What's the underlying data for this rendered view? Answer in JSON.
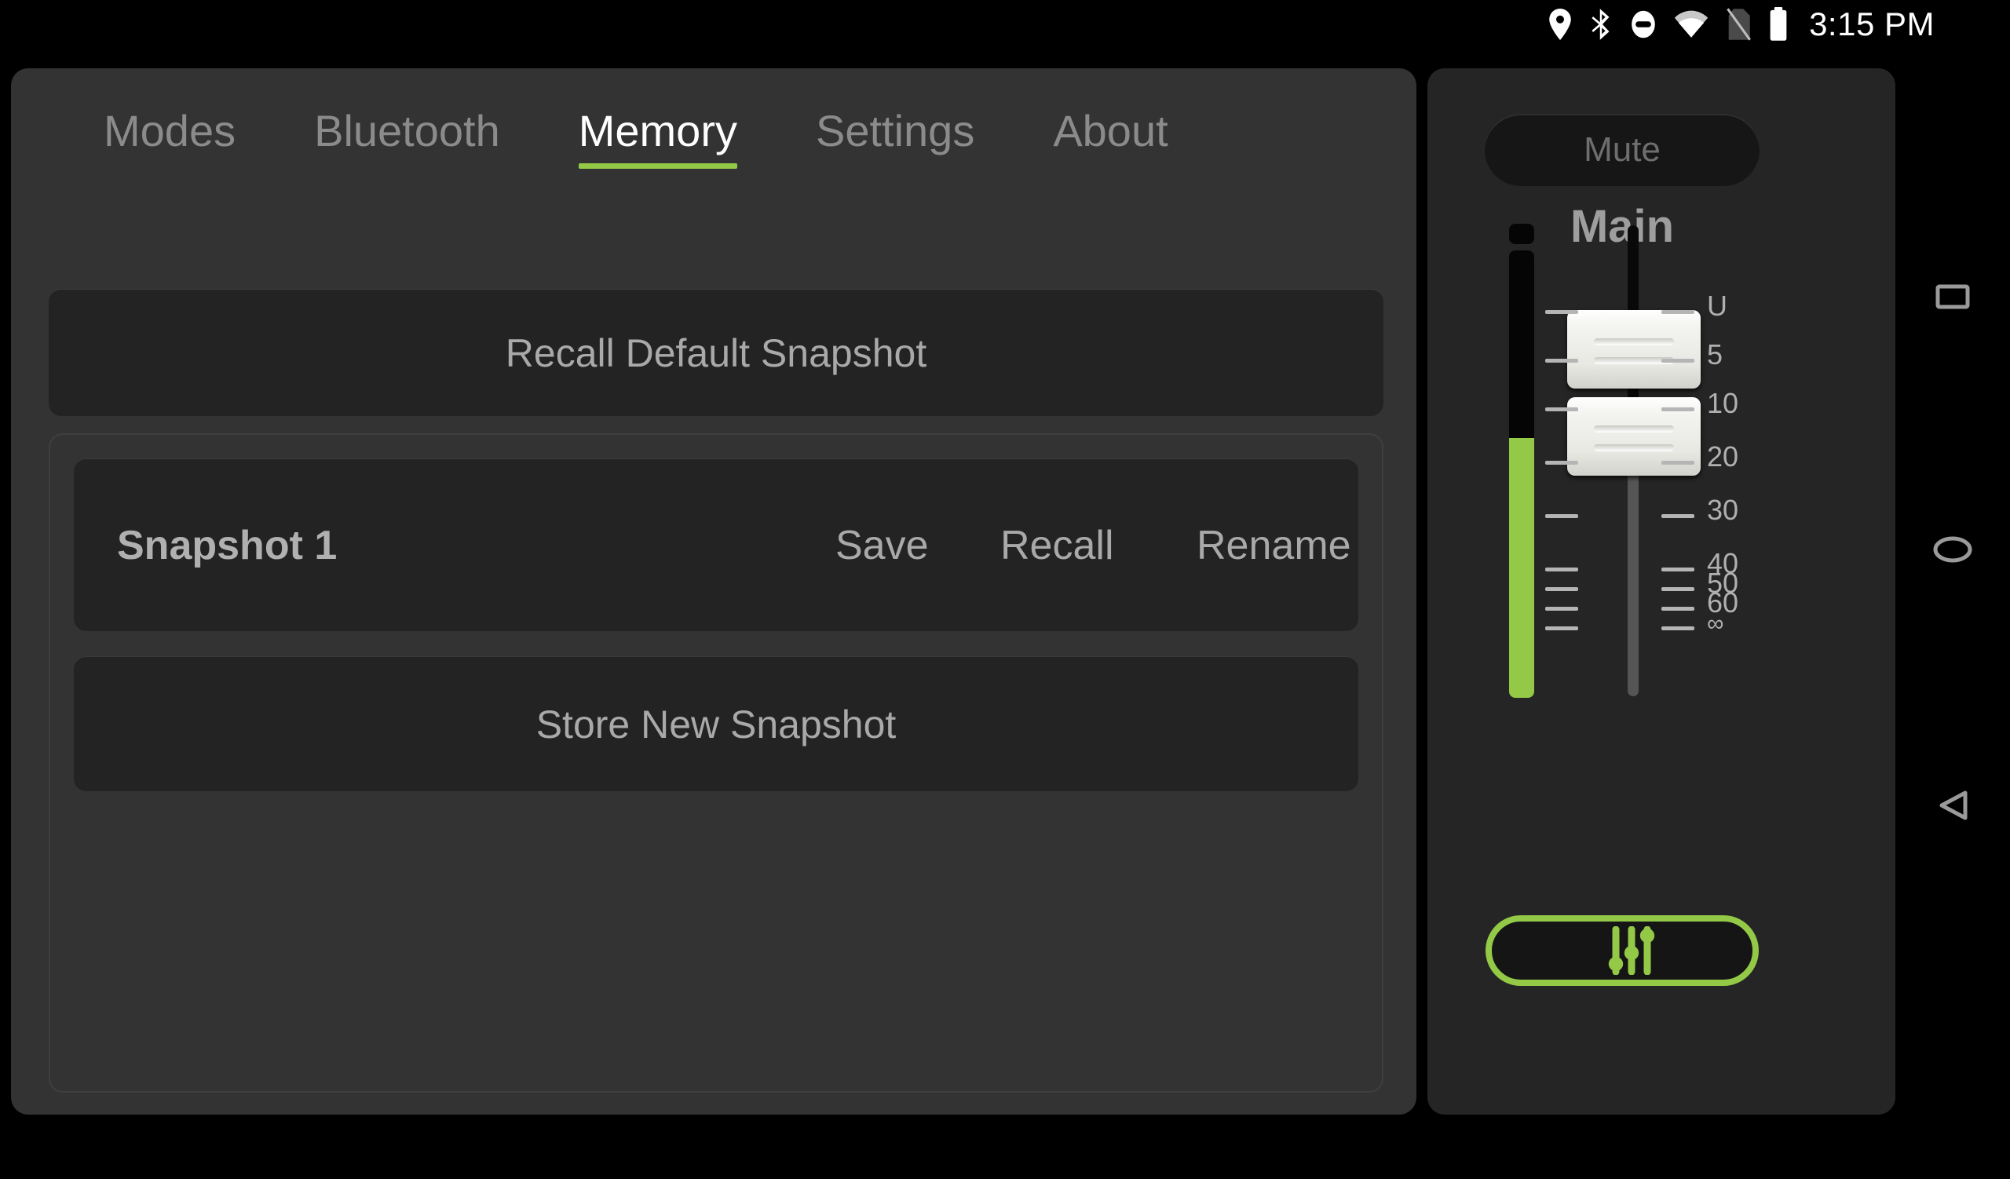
{
  "status_bar": {
    "time": "3:15 PM",
    "icons": [
      "location-pin-icon",
      "bluetooth-icon",
      "do-not-disturb-icon",
      "wifi-icon",
      "no-sim-icon",
      "battery-icon"
    ]
  },
  "colors": {
    "accent_green": "#93c947",
    "panel_left_bg": "#333333",
    "panel_right_bg": "#252525",
    "button_bg": "#232323",
    "text_muted": "#a9a9a9",
    "text_active": "#ffffff"
  },
  "tabs": [
    {
      "label": "Modes",
      "active": false
    },
    {
      "label": "Bluetooth",
      "active": false
    },
    {
      "label": "Memory",
      "active": true
    },
    {
      "label": "Settings",
      "active": false
    },
    {
      "label": "About",
      "active": false
    }
  ],
  "memory": {
    "recall_default_label": "Recall Default Snapshot",
    "snapshots": [
      {
        "name": "Snapshot 1",
        "actions": [
          "Save",
          "Recall",
          "Rename"
        ]
      }
    ],
    "store_new_label": "Store New Snapshot"
  },
  "channel_strip": {
    "mute_label": "Mute",
    "channel_label": "Main",
    "meter_level_percent": 58,
    "fader_scale": [
      {
        "label": "U",
        "pos_percent": 19
      },
      {
        "label": "5",
        "pos_percent": 29
      },
      {
        "label": "10",
        "pos_percent": 39
      },
      {
        "label": "20",
        "pos_percent": 50
      },
      {
        "label": "30",
        "pos_percent": 61
      },
      {
        "label": "40",
        "pos_percent": 72
      },
      {
        "label": "50",
        "pos_percent": 76
      },
      {
        "label": "60",
        "pos_percent": 80
      },
      {
        "label": "∞",
        "pos_percent": 84
      }
    ],
    "faders": [
      {
        "name": "fader-handle-upper",
        "pos_percent": 19
      },
      {
        "name": "fader-handle-lower",
        "pos_percent": 37
      }
    ],
    "eq_button_icon": "sliders-icon"
  },
  "nav_bar": {
    "buttons": [
      {
        "name": "recents-button",
        "icon": "square-icon"
      },
      {
        "name": "home-button",
        "icon": "circle-icon"
      },
      {
        "name": "back-button",
        "icon": "triangle-left-icon"
      }
    ]
  }
}
